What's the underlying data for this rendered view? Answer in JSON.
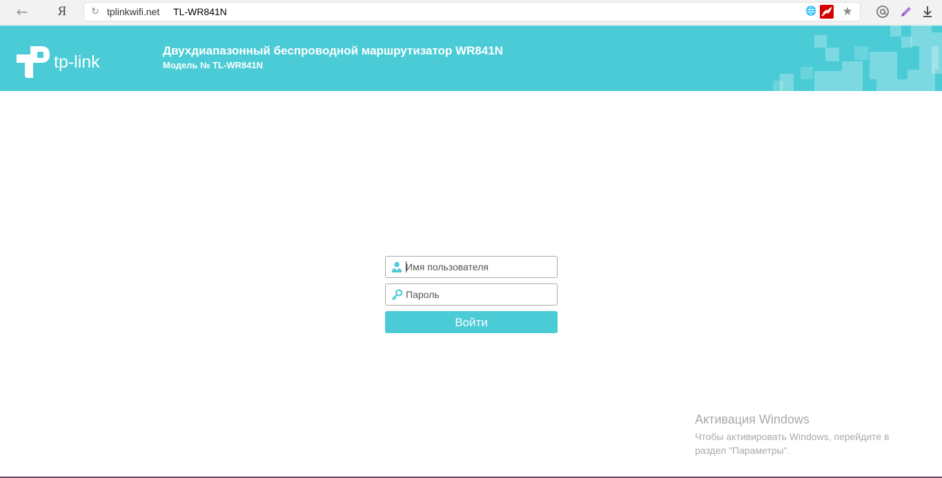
{
  "browser": {
    "back_icon": "arrow-left-icon",
    "yandex_logo": "Я",
    "reload_icon": "reload-icon",
    "url_host": "tplinkwifi.net",
    "page_title": "TL-WR841N",
    "translate_icon": "globe-icon",
    "adblock_icon": "adblock-icon",
    "bookmark_icon": "star-icon",
    "mail_icon": "at-sign-icon",
    "pen_icon": "pen-icon",
    "download_icon": "download-icon"
  },
  "header": {
    "brand": "tp-link",
    "title": "Двухдиапазонный беспроводной маршрутизатор WR841N",
    "model": "Модель № TL-WR841N",
    "color": "#4acbd6"
  },
  "login": {
    "username_placeholder": "Имя пользователя",
    "username_value": "",
    "password_placeholder": "Пароль",
    "password_value": "",
    "submit_label": "Войти",
    "user_icon": "user-icon",
    "password_icon": "key-icon"
  },
  "watermark": {
    "title": "Активация Windows",
    "text": "Чтобы активировать Windows, перейдите в раздел \"Параметры\"."
  }
}
